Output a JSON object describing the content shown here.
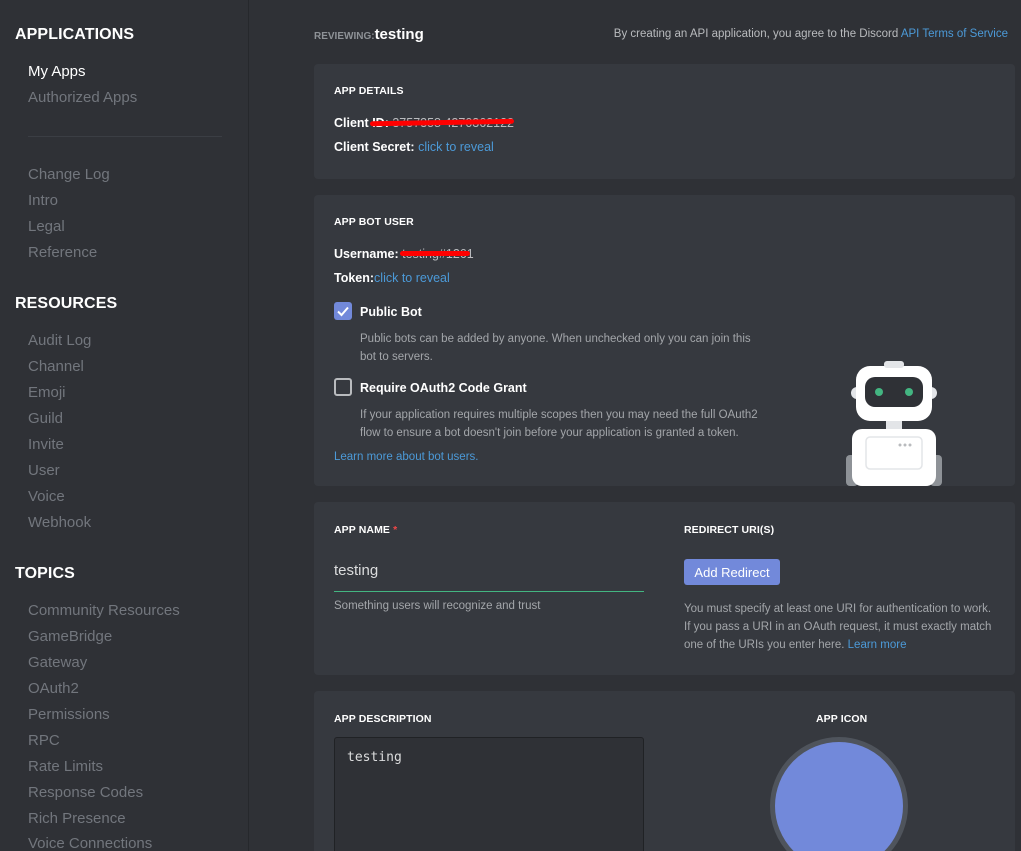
{
  "sidebar": {
    "applications_heading": "APPLICATIONS",
    "applications": [
      {
        "label": "My Apps",
        "active": true
      },
      {
        "label": "Authorized Apps",
        "active": false
      }
    ],
    "docs": [
      "Change Log",
      "Intro",
      "Legal",
      "Reference"
    ],
    "resources_heading": "RESOURCES",
    "resources": [
      "Audit Log",
      "Channel",
      "Emoji",
      "Guild",
      "Invite",
      "User",
      "Voice",
      "Webhook"
    ],
    "topics_heading": "TOPICS",
    "topics": [
      "Community Resources",
      "GameBridge",
      "Gateway",
      "OAuth2",
      "Permissions",
      "RPC",
      "Rate Limits",
      "Response Codes",
      "Rich Presence",
      "Voice Connections"
    ]
  },
  "header": {
    "reviewing_label": "REVIEWING:",
    "app_name": "testing",
    "tos_prefix": "By creating an API application, you agree to the Discord ",
    "tos_link": "API Terms of Service"
  },
  "app_details": {
    "title": "APP DETAILS",
    "client_id_label": "Client ID:",
    "client_id_value": "3757358        4270362122",
    "client_secret_label": "Client Secret:",
    "client_secret_link": "click to reveal"
  },
  "bot_user": {
    "title": "APP BOT USER",
    "username_label": "Username:",
    "username_value": "testing#1261",
    "token_label": "Token:",
    "token_link": "click to reveal",
    "public_bot": {
      "label": "Public Bot",
      "checked": true,
      "description": "Public bots can be added by anyone. When unchecked only you can join this bot to servers."
    },
    "oauth_grant": {
      "label": "Require OAuth2 Code Grant",
      "checked": false,
      "description": "If your application requires multiple scopes then you may need the full OAuth2 flow to ensure a bot doesn't join before your application is granted a token."
    },
    "learn_more": "Learn more about bot users."
  },
  "app_name_section": {
    "title": "APP NAME",
    "required_mark": "*",
    "value": "testing",
    "hint": "Something users will recognize and trust"
  },
  "redirect_section": {
    "title": "REDIRECT URI(S)",
    "button": "Add Redirect",
    "hint": "You must specify at least one URI for authentication to work. If you pass a URI in an OAuth request, it must exactly match one of the URIs you enter here. ",
    "learn_more": "Learn more"
  },
  "description_section": {
    "title": "APP DESCRIPTION",
    "value": "testing"
  },
  "icon_section": {
    "title": "APP ICON"
  },
  "colors": {
    "accent": "#7289da",
    "link": "#4c9ad8",
    "success_underline": "#43b581",
    "redaction": "#ff0000"
  }
}
